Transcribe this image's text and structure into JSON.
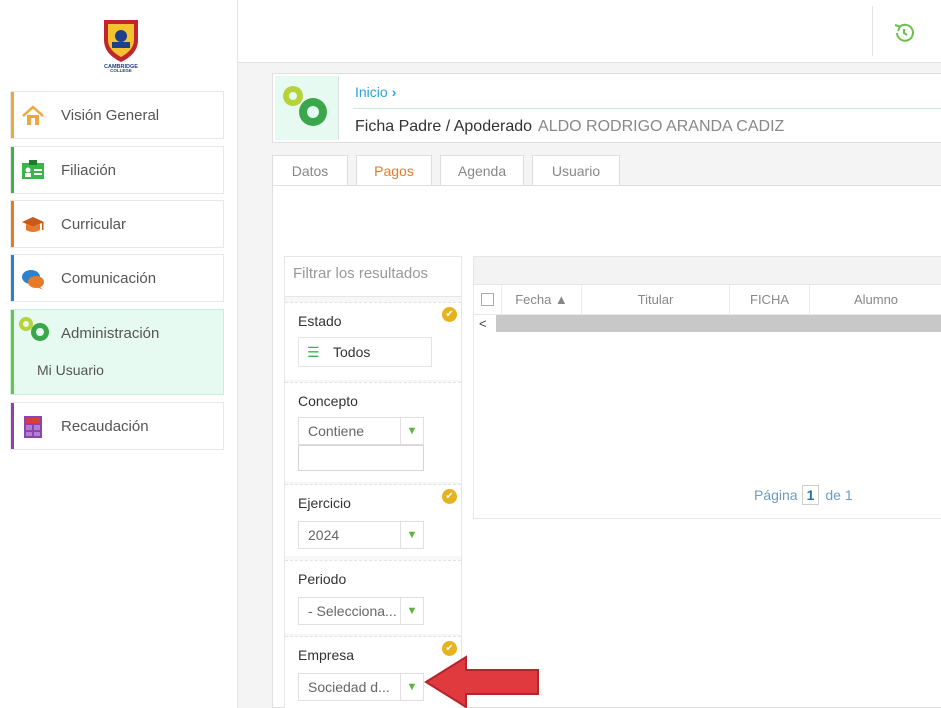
{
  "logo": {
    "text_top": "CAMBRIDGE",
    "text_bottom": "COLLEGE"
  },
  "sidebar": {
    "items": [
      {
        "label": "Visión General",
        "icon": "home-icon",
        "color": "#f0a73a"
      },
      {
        "label": "Filiación",
        "icon": "id-card-icon",
        "color": "#39b54a"
      },
      {
        "label": "Curricular",
        "icon": "graduation-cap-icon",
        "color": "#e87a26"
      },
      {
        "label": "Comunicación",
        "icon": "chat-bubbles-icon",
        "color": "#2a82d0"
      },
      {
        "label": "Administración",
        "icon": "gears-icon",
        "color": "#6cc24a",
        "sub": "Mi Usuario"
      },
      {
        "label": "Recaudación",
        "icon": "calculator-icon",
        "color": "#8e44ad"
      }
    ]
  },
  "header": {
    "history_icon": "history-icon"
  },
  "breadcrumb": {
    "root": "Inicio",
    "chev": "›"
  },
  "page": {
    "title": "Ficha Padre / Apoderado",
    "subject_name": "ALDO RODRIGO ARANDA CADIZ"
  },
  "tabs": [
    {
      "label": "Datos",
      "active": false
    },
    {
      "label": "Pagos",
      "active": true
    },
    {
      "label": "Agenda",
      "active": false
    },
    {
      "label": "Usuario",
      "active": false
    }
  ],
  "filters": {
    "placeholder": "Filtrar los resultados",
    "estado": {
      "title": "Estado",
      "value": "Todos"
    },
    "concepto": {
      "title": "Concepto",
      "operator": "Contiene",
      "value": ""
    },
    "ejercicio": {
      "title": "Ejercicio",
      "value": "2024"
    },
    "periodo": {
      "title": "Periodo",
      "value": "- Selecciona..."
    },
    "empresa": {
      "title": "Empresa",
      "value": "Sociedad d..."
    }
  },
  "grid": {
    "columns": [
      {
        "label": "Fecha ▲"
      },
      {
        "label": "Titular"
      },
      {
        "label": "FICHA"
      },
      {
        "label": "Alumno"
      }
    ],
    "scroll_left": "<",
    "pager": {
      "label": "Página",
      "page": "1",
      "of": "de 1"
    }
  },
  "colors": {
    "accent_orange": "#e87a26",
    "accent_green": "#5db33c",
    "link_blue": "#2aa6d6",
    "check_gold": "#e6b31e",
    "annotation_red": "#e0393e"
  }
}
